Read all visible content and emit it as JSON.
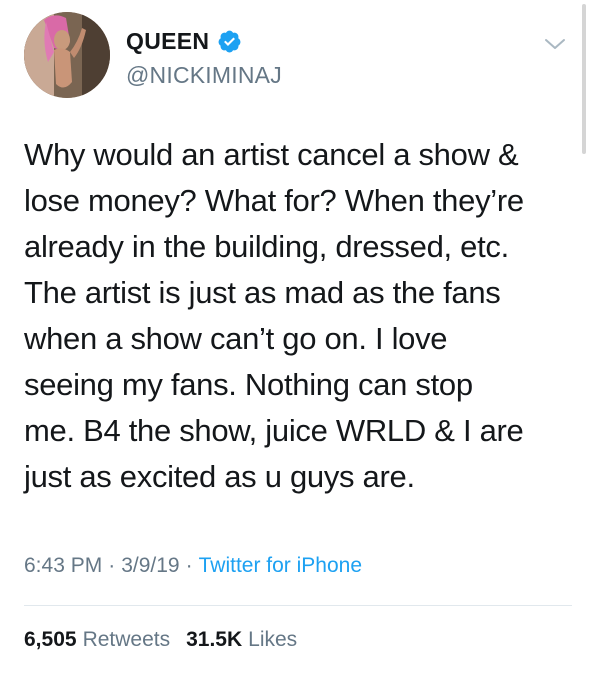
{
  "user": {
    "display_name": "QUEEN",
    "handle": "@NICKIMINAJ",
    "verified": true
  },
  "icons": {
    "verified": "verified-badge-icon",
    "menu": "chevron-down-icon"
  },
  "tweet": {
    "text": "Why would an artist cancel a show &\nlose money? What for? When they’re\nalready in the building, dressed, etc.\nThe artist is just as mad as the fans\nwhen a show can’t go on. I love\nseeing my fans. Nothing can stop\nme. B4 the show, juice WRLD & I are\njust as excited as u guys are.",
    "time": "6:43 PM",
    "date": "3/9/19",
    "source": "Twitter for iPhone",
    "separator": "·"
  },
  "stats": {
    "retweets_count": "6,505",
    "retweets_label": "Retweets",
    "likes_count": "31.5K",
    "likes_label": "Likes"
  },
  "colors": {
    "text": "#14171a",
    "secondary": "#657786",
    "link": "#1da1f2",
    "divider": "#e1e8ed"
  }
}
